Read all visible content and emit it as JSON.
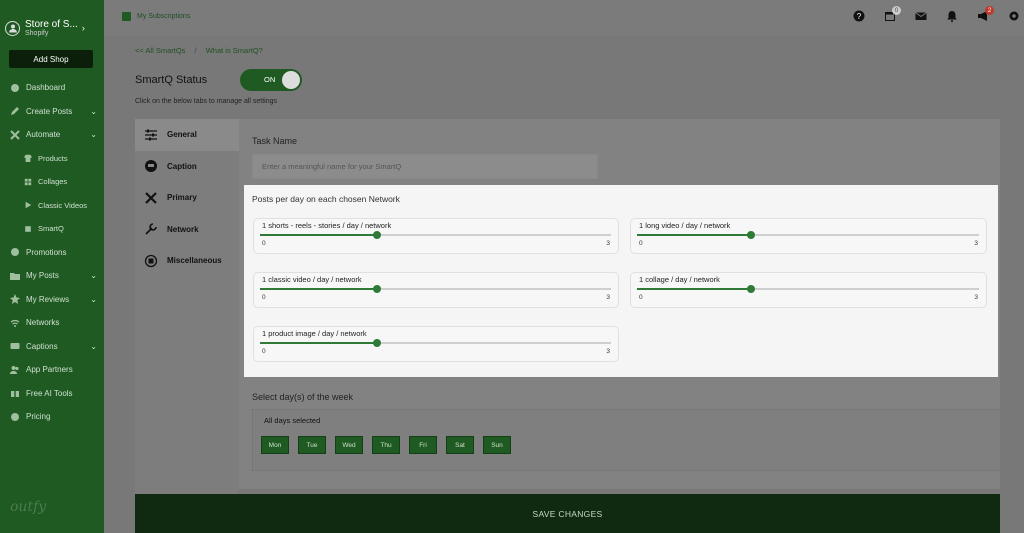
{
  "sidebar": {
    "store_name": "Store of S...",
    "store_platform": "Shopify",
    "add_shop": "Add Shop",
    "items": [
      {
        "label": "Dashboard",
        "icon": "palette-icon"
      },
      {
        "label": "Create Posts",
        "icon": "pencil-icon"
      },
      {
        "label": "Automate",
        "icon": "tools-icon"
      },
      {
        "label": "Products",
        "icon": "shirt-icon"
      },
      {
        "label": "Collages",
        "icon": "grid-icon"
      },
      {
        "label": "Classic Videos",
        "icon": "play-icon"
      },
      {
        "label": "SmartQ",
        "icon": "cube-icon"
      },
      {
        "label": "Promotions",
        "icon": "tag-icon"
      },
      {
        "label": "My Posts",
        "icon": "folder-icon"
      },
      {
        "label": "My Reviews",
        "icon": "star-icon"
      },
      {
        "label": "Networks",
        "icon": "wifi-icon"
      },
      {
        "label": "Captions",
        "icon": "caption-icon"
      },
      {
        "label": "App Partners",
        "icon": "users-icon"
      },
      {
        "label": "Free AI Tools",
        "icon": "gift-icon"
      },
      {
        "label": "Pricing",
        "icon": "coin-icon"
      }
    ],
    "logo": "outfy"
  },
  "topbar": {
    "page_title": "My Subscriptions",
    "calendar_badge": "0",
    "announce_badge": "2"
  },
  "breadcrumb": {
    "back": "<< All SmartQs",
    "help": "What is SmartQ?"
  },
  "status": {
    "title": "SmartQ Status",
    "toggle": "ON",
    "hint": "Click on the below tabs to manage all settings"
  },
  "tabs": [
    {
      "label": "General"
    },
    {
      "label": "Caption"
    },
    {
      "label": "Primary"
    },
    {
      "label": "Network"
    },
    {
      "label": "Miscellaneous"
    }
  ],
  "task": {
    "label": "Task Name",
    "placeholder": "Enter a meaningful name for your SmartQ"
  },
  "posts": {
    "title": "Posts per day on each chosen Network",
    "sliders": [
      {
        "label": "1 shorts - reels - stories / day / network",
        "min": "0",
        "max": "3",
        "value": 1
      },
      {
        "label": "1 long video / day / network",
        "min": "0",
        "max": "3",
        "value": 1
      },
      {
        "label": "1 classic video / day / network",
        "min": "0",
        "max": "3",
        "value": 1
      },
      {
        "label": "1 collage / day / network",
        "min": "0",
        "max": "3",
        "value": 1
      },
      {
        "label": "1 product image / day / network",
        "min": "0",
        "max": "3",
        "value": 1
      }
    ]
  },
  "days": {
    "label": "Select day(s) of the week",
    "selected_text": "All days selected",
    "list": [
      "Mon",
      "Tue",
      "Wed",
      "Thu",
      "Fri",
      "Sat",
      "Sun"
    ]
  },
  "save_label": "SAVE CHANGES",
  "colors": {
    "brand_green": "#1f5a22",
    "slider_green": "#2f7a37",
    "badge_red": "#c0392b"
  }
}
